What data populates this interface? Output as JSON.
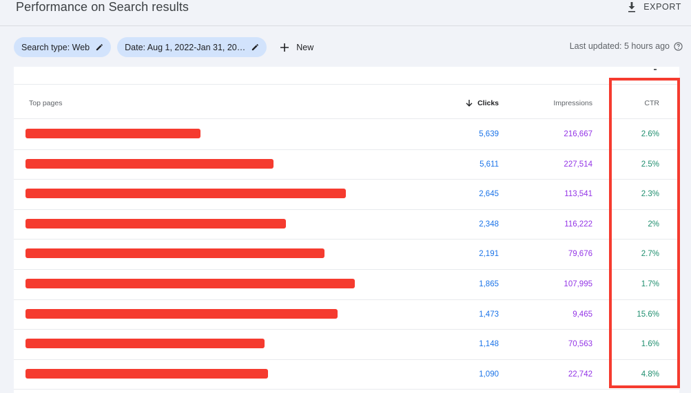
{
  "header": {
    "title": "Performance on Search results",
    "export_label": "EXPORT"
  },
  "filters": {
    "search_type": "Search type: Web",
    "date": "Date: Aug 1, 2022-Jan 31, 20…",
    "new_label": "New",
    "last_updated": "Last updated: 5 hours ago"
  },
  "table": {
    "headers": {
      "page": "Top pages",
      "clicks": "Clicks",
      "impressions": "Impressions",
      "ctr": "CTR"
    },
    "rows": [
      {
        "clicks": "5,639",
        "impressions": "216,667",
        "ctr": "2.6%"
      },
      {
        "clicks": "5,611",
        "impressions": "227,514",
        "ctr": "2.5%"
      },
      {
        "clicks": "2,645",
        "impressions": "113,541",
        "ctr": "2.3%"
      },
      {
        "clicks": "2,348",
        "impressions": "116,222",
        "ctr": "2%"
      },
      {
        "clicks": "2,191",
        "impressions": "79,676",
        "ctr": "2.7%"
      },
      {
        "clicks": "1,865",
        "impressions": "107,995",
        "ctr": "1.7%"
      },
      {
        "clicks": "1,473",
        "impressions": "9,465",
        "ctr": "15.6%"
      },
      {
        "clicks": "1,148",
        "impressions": "70,563",
        "ctr": "1.6%"
      },
      {
        "clicks": "1,090",
        "impressions": "22,742",
        "ctr": "4.8%"
      }
    ]
  },
  "colors": {
    "redaction": "#f53b2f",
    "highlight_box": "#f53b2f",
    "clicks": "#1a73e8",
    "impressions": "#9334e6",
    "ctr": "#1e8e6e",
    "chip": "#d2e3fc"
  },
  "icons": {
    "export": "download-icon",
    "edit": "pencil-icon",
    "new": "plus-icon",
    "help": "help-circle-icon",
    "sort": "arrow-down-icon"
  }
}
